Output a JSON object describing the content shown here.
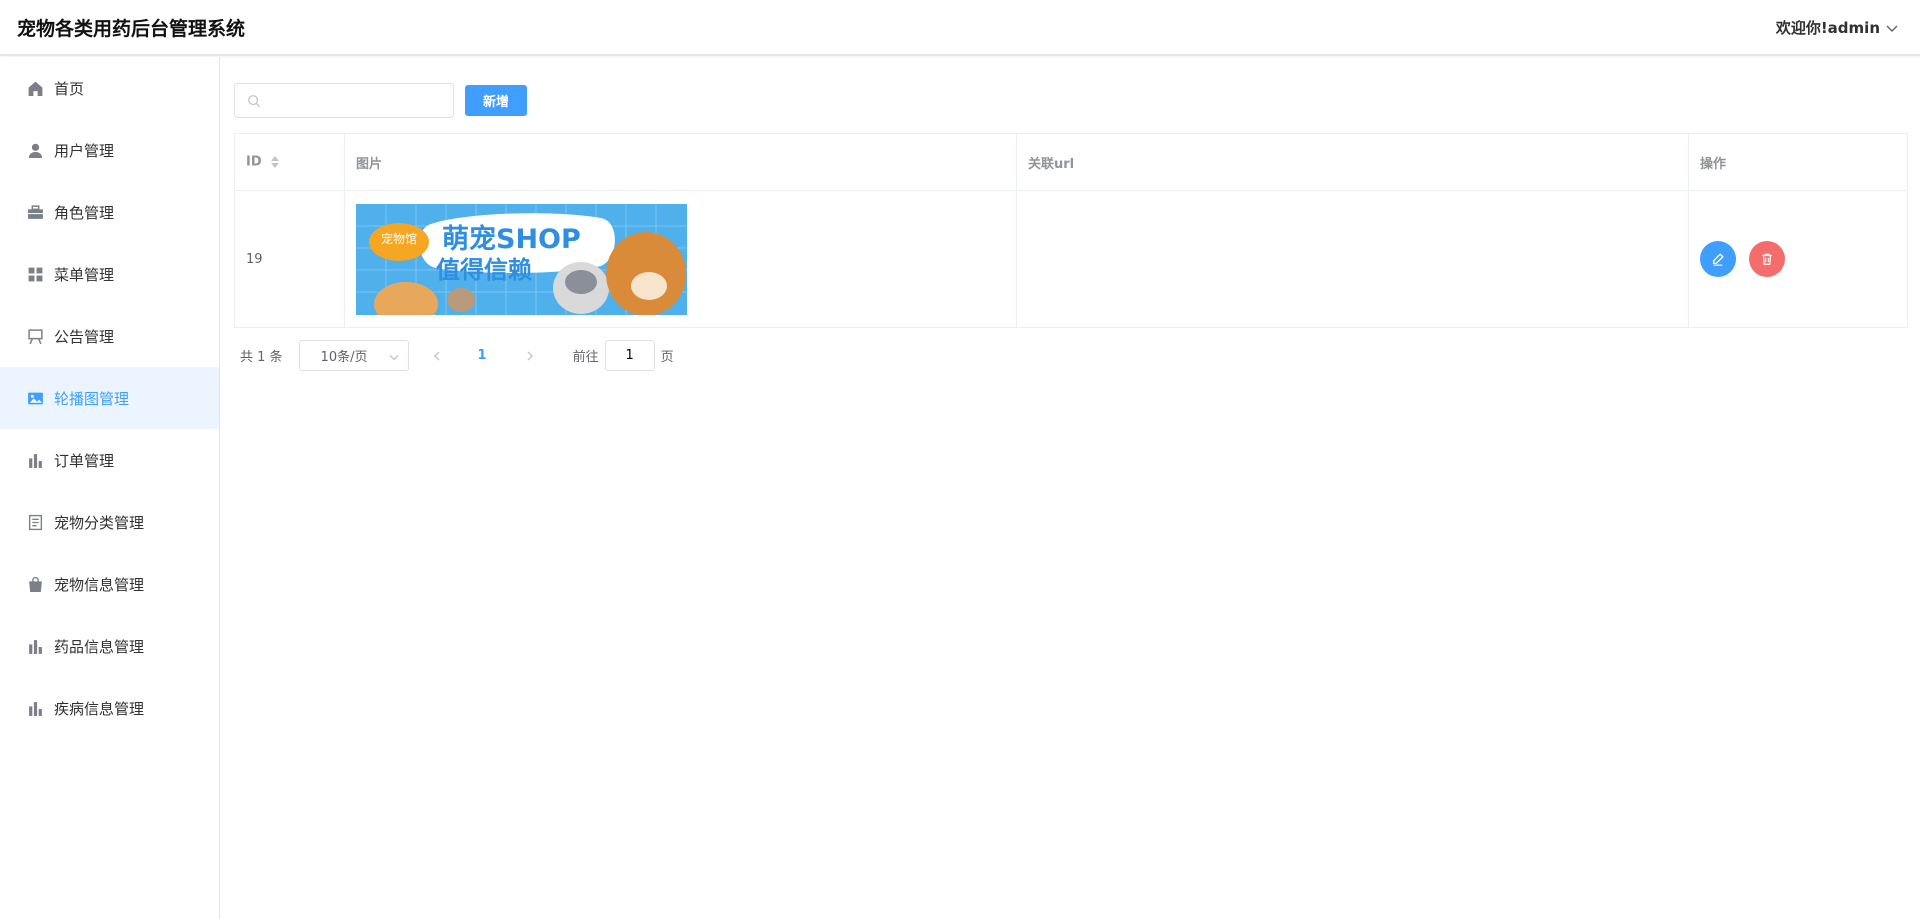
{
  "header": {
    "title": "宠物各类用药后台管理系统",
    "welcome": "欢迎你!admin"
  },
  "sidebar": {
    "items": [
      {
        "label": "首页",
        "icon": "home-icon"
      },
      {
        "label": "用户管理",
        "icon": "user-icon"
      },
      {
        "label": "角色管理",
        "icon": "briefcase-icon"
      },
      {
        "label": "菜单管理",
        "icon": "grid-icon"
      },
      {
        "label": "公告管理",
        "icon": "board-icon"
      },
      {
        "label": "轮播图管理",
        "icon": "picture-icon",
        "active": true
      },
      {
        "label": "订单管理",
        "icon": "bar-chart-icon"
      },
      {
        "label": "宠物分类管理",
        "icon": "document-icon"
      },
      {
        "label": "宠物信息管理",
        "icon": "shopping-bag-icon"
      },
      {
        "label": "药品信息管理",
        "icon": "bar-chart-icon"
      },
      {
        "label": "疾病信息管理",
        "icon": "bar-chart-icon"
      }
    ]
  },
  "toolbar": {
    "search_placeholder": "",
    "add_label": "新增"
  },
  "table": {
    "columns": [
      "ID",
      "图片",
      "关联url",
      "操作"
    ],
    "rows": [
      {
        "id": "19",
        "image_text_1": "萌宠SHOP",
        "image_text_2": "值得信赖",
        "badge": "宠物馆",
        "url": ""
      }
    ]
  },
  "pagination": {
    "total": "共 1 条",
    "page_size": "10条/页",
    "current_page": "1",
    "goto_label": "前往",
    "goto_value": "1",
    "page_suffix": "页"
  },
  "colors": {
    "primary": "#409eff",
    "danger": "#f56c6c",
    "active_bg": "#ecf5ff"
  }
}
